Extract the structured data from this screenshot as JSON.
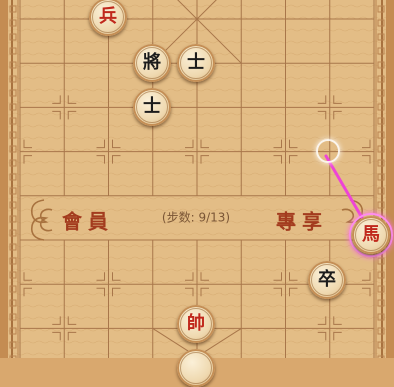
{
  "board": {
    "river_left": "會員",
    "river_right": "專享",
    "steps_label": "步数",
    "steps_value": "9/13",
    "steps_prefix": "(",
    "steps_colon": ":",
    "steps_suffix": ")",
    "line_color": "#a8764a",
    "board_color": "#e3bd86",
    "border_color": "#a8723f"
  },
  "pieces": [
    {
      "name": "red-soldier-piece",
      "text": "兵",
      "side": "red"
    },
    {
      "name": "black-general-piece",
      "text": "將",
      "side": "black"
    },
    {
      "name": "black-advisor-piece-1",
      "text": "士",
      "side": "black"
    },
    {
      "name": "black-advisor-piece-2",
      "text": "士",
      "side": "black"
    },
    {
      "name": "red-horse-piece",
      "text": "馬",
      "side": "red"
    },
    {
      "name": "black-soldier-piece",
      "text": "卒",
      "side": "black"
    },
    {
      "name": "red-general-piece",
      "text": "帥",
      "side": "red"
    },
    {
      "name": "red-piece-partial",
      "text": "",
      "side": "red"
    }
  ],
  "hint": {
    "from": "red-horse-piece",
    "arrow_color": "#ee44d6"
  }
}
